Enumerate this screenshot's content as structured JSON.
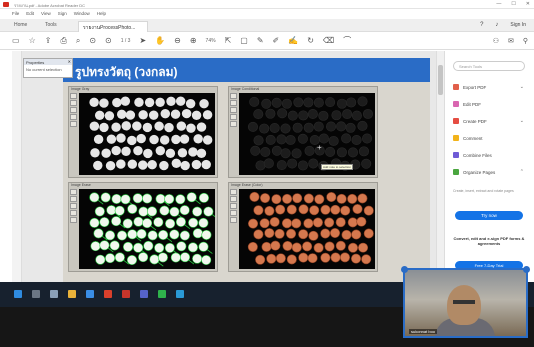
{
  "window": {
    "title": "รายงาน.pdf - Adobe Acrobat Reader DC"
  },
  "menu": [
    "File",
    "Edit",
    "View",
    "Sign",
    "Window",
    "Help"
  ],
  "tabs": {
    "home": "Home",
    "tools": "Tools",
    "document": "รายงานProcessPhoto..."
  },
  "header": {
    "help_icon": "help-icon",
    "bell_icon": "bell-icon",
    "signin": "Sign In"
  },
  "toolbar": {
    "page": "1 / 3",
    "zoom": "74%"
  },
  "properties": {
    "title": "Properties",
    "body": "No current selection"
  },
  "slide": {
    "title": "รูปทรงวัตถุ (วงกลม)",
    "panels": [
      {
        "name": "Image Gray"
      },
      {
        "name": "Image Conditional"
      },
      {
        "name": "Image Erase"
      },
      {
        "name": "Image Erase (Color)"
      }
    ],
    "tooltip": "Add note to selection"
  },
  "right_pane": {
    "search_placeholder": "Search Tools",
    "tools": [
      {
        "label": "Export PDF",
        "color": "#e15f4a"
      },
      {
        "label": "Edit PDF",
        "color": "#d966b0"
      },
      {
        "label": "Create PDF",
        "color": "#e54d42"
      },
      {
        "label": "Comment",
        "color": "#f2b31a"
      },
      {
        "label": "Combine Files",
        "color": "#6f5bd6"
      },
      {
        "label": "Organize Pages",
        "color": "#4aa63f"
      }
    ],
    "promo_text": "Create, insert, extract and rotate pages",
    "try_now": "Try now",
    "promo2": "Convert, edit and e-sign PDF forms & agreements",
    "free_trial": "Free 7-Day Trial"
  },
  "video": {
    "name": "sukonnat boo"
  },
  "colors": {
    "accent": "#1473e6",
    "banner": "#2a6cc6",
    "taskbar": "#17212e"
  }
}
